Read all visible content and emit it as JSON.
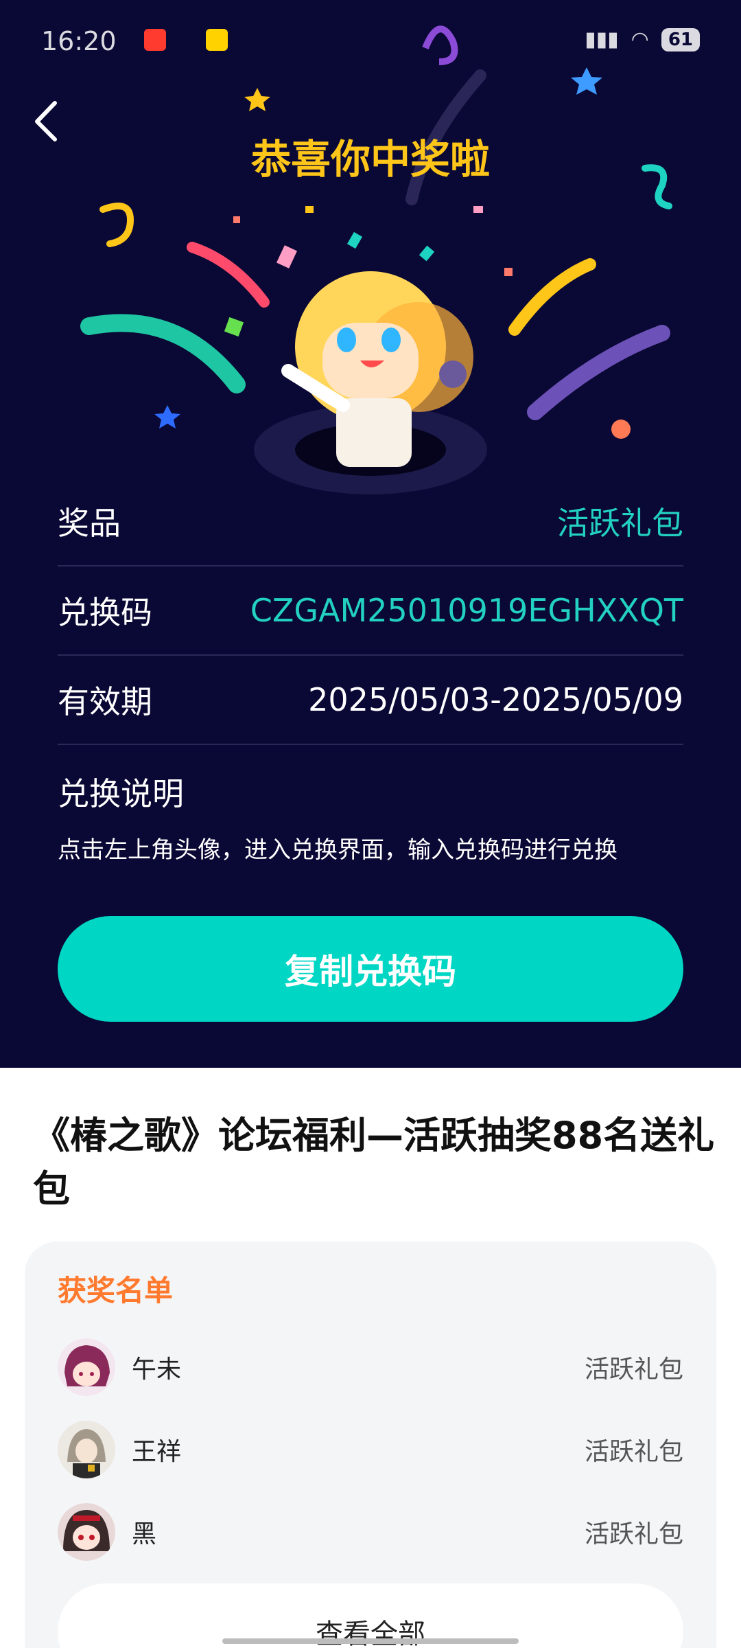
{
  "status_bar": {
    "time": "16:20",
    "battery": "61",
    "icons": [
      "app-icon-red",
      "app-icon-yellow",
      "signal-icon",
      "wifi-icon"
    ]
  },
  "header": {
    "title": "恭喜你中奖啦",
    "back_icon": "back-chevron-icon"
  },
  "prize": {
    "prize_label": "奖品",
    "prize_value": "活跃礼包",
    "code_label": "兑换码",
    "code_value": "CZGAM25010919EGHXXQT",
    "validity_label": "有效期",
    "validity_value": "2025/05/03-2025/05/09",
    "instructions_label": "兑换说明",
    "instructions_text": "点击左上角头像，进入兑换界面，输入兑换码进行兑换"
  },
  "copy_button": "复制兑换码",
  "event": {
    "title": "《椿之歌》论坛福利—活跃抽奖88名送礼包"
  },
  "winners": {
    "title": "获奖名单",
    "list": [
      {
        "name": "午未",
        "prize": "活跃礼包"
      },
      {
        "name": "王祥",
        "prize": "活跃礼包"
      },
      {
        "name": "黑",
        "prize": "活跃礼包"
      }
    ],
    "view_all": "查看全部"
  },
  "colors": {
    "hero_bg": "#0a0834",
    "heading": "#ffc61a",
    "teal": "#00d6c4",
    "orange": "#ff7a2e"
  }
}
